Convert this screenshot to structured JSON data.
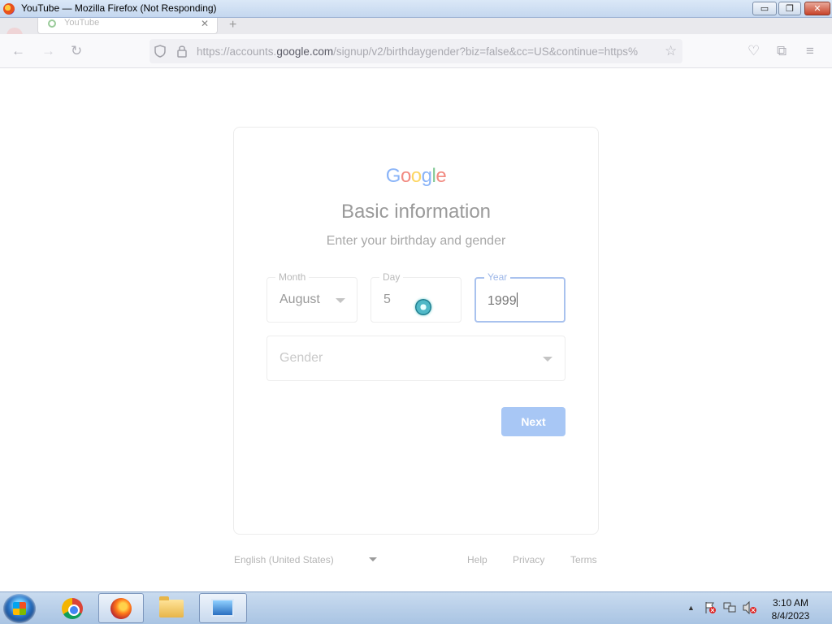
{
  "window": {
    "title": "YouTube — Mozilla Firefox (Not Responding)",
    "min_glyph": "▭",
    "max_glyph": "❐",
    "close_glyph": "✕"
  },
  "tabs": [
    {
      "label": "YouTube",
      "close": "✕"
    }
  ],
  "new_tab_glyph": "+",
  "navbar": {
    "back_glyph": "←",
    "forward_glyph": "→",
    "reload_glyph": "↻",
    "url_prefix": "https://accounts.",
    "url_host": "google.com",
    "url_path": "/signup/v2/birthdaygender?biz=false&cc=US&continue=https%",
    "bookmark_glyph": "☆",
    "pocket_glyph": "♡",
    "extensions_glyph": "⧉",
    "menu_glyph": "≡"
  },
  "page": {
    "logo_letters": [
      {
        "char": "G",
        "color": "#8ab4f8"
      },
      {
        "char": "o",
        "color": "#f28b82"
      },
      {
        "char": "o",
        "color": "#fdd663"
      },
      {
        "char": "g",
        "color": "#8ab4f8"
      },
      {
        "char": "l",
        "color": "#81c995"
      },
      {
        "char": "e",
        "color": "#f28b82"
      }
    ],
    "heading": "Basic information",
    "subheading": "Enter your birthday and gender",
    "month": {
      "label": "Month",
      "value": "August"
    },
    "day": {
      "label": "Day",
      "value": "5"
    },
    "year": {
      "label": "Year",
      "value": "1999"
    },
    "gender": {
      "placeholder": "Gender"
    },
    "next_label": "Next"
  },
  "footer": {
    "language": "English (United States)",
    "help": "Help",
    "privacy": "Privacy",
    "terms": "Terms"
  },
  "taskbar": {
    "clock_time": "3:10 AM",
    "clock_date": "8/4/2023",
    "tray_expand_glyph": "▲"
  }
}
